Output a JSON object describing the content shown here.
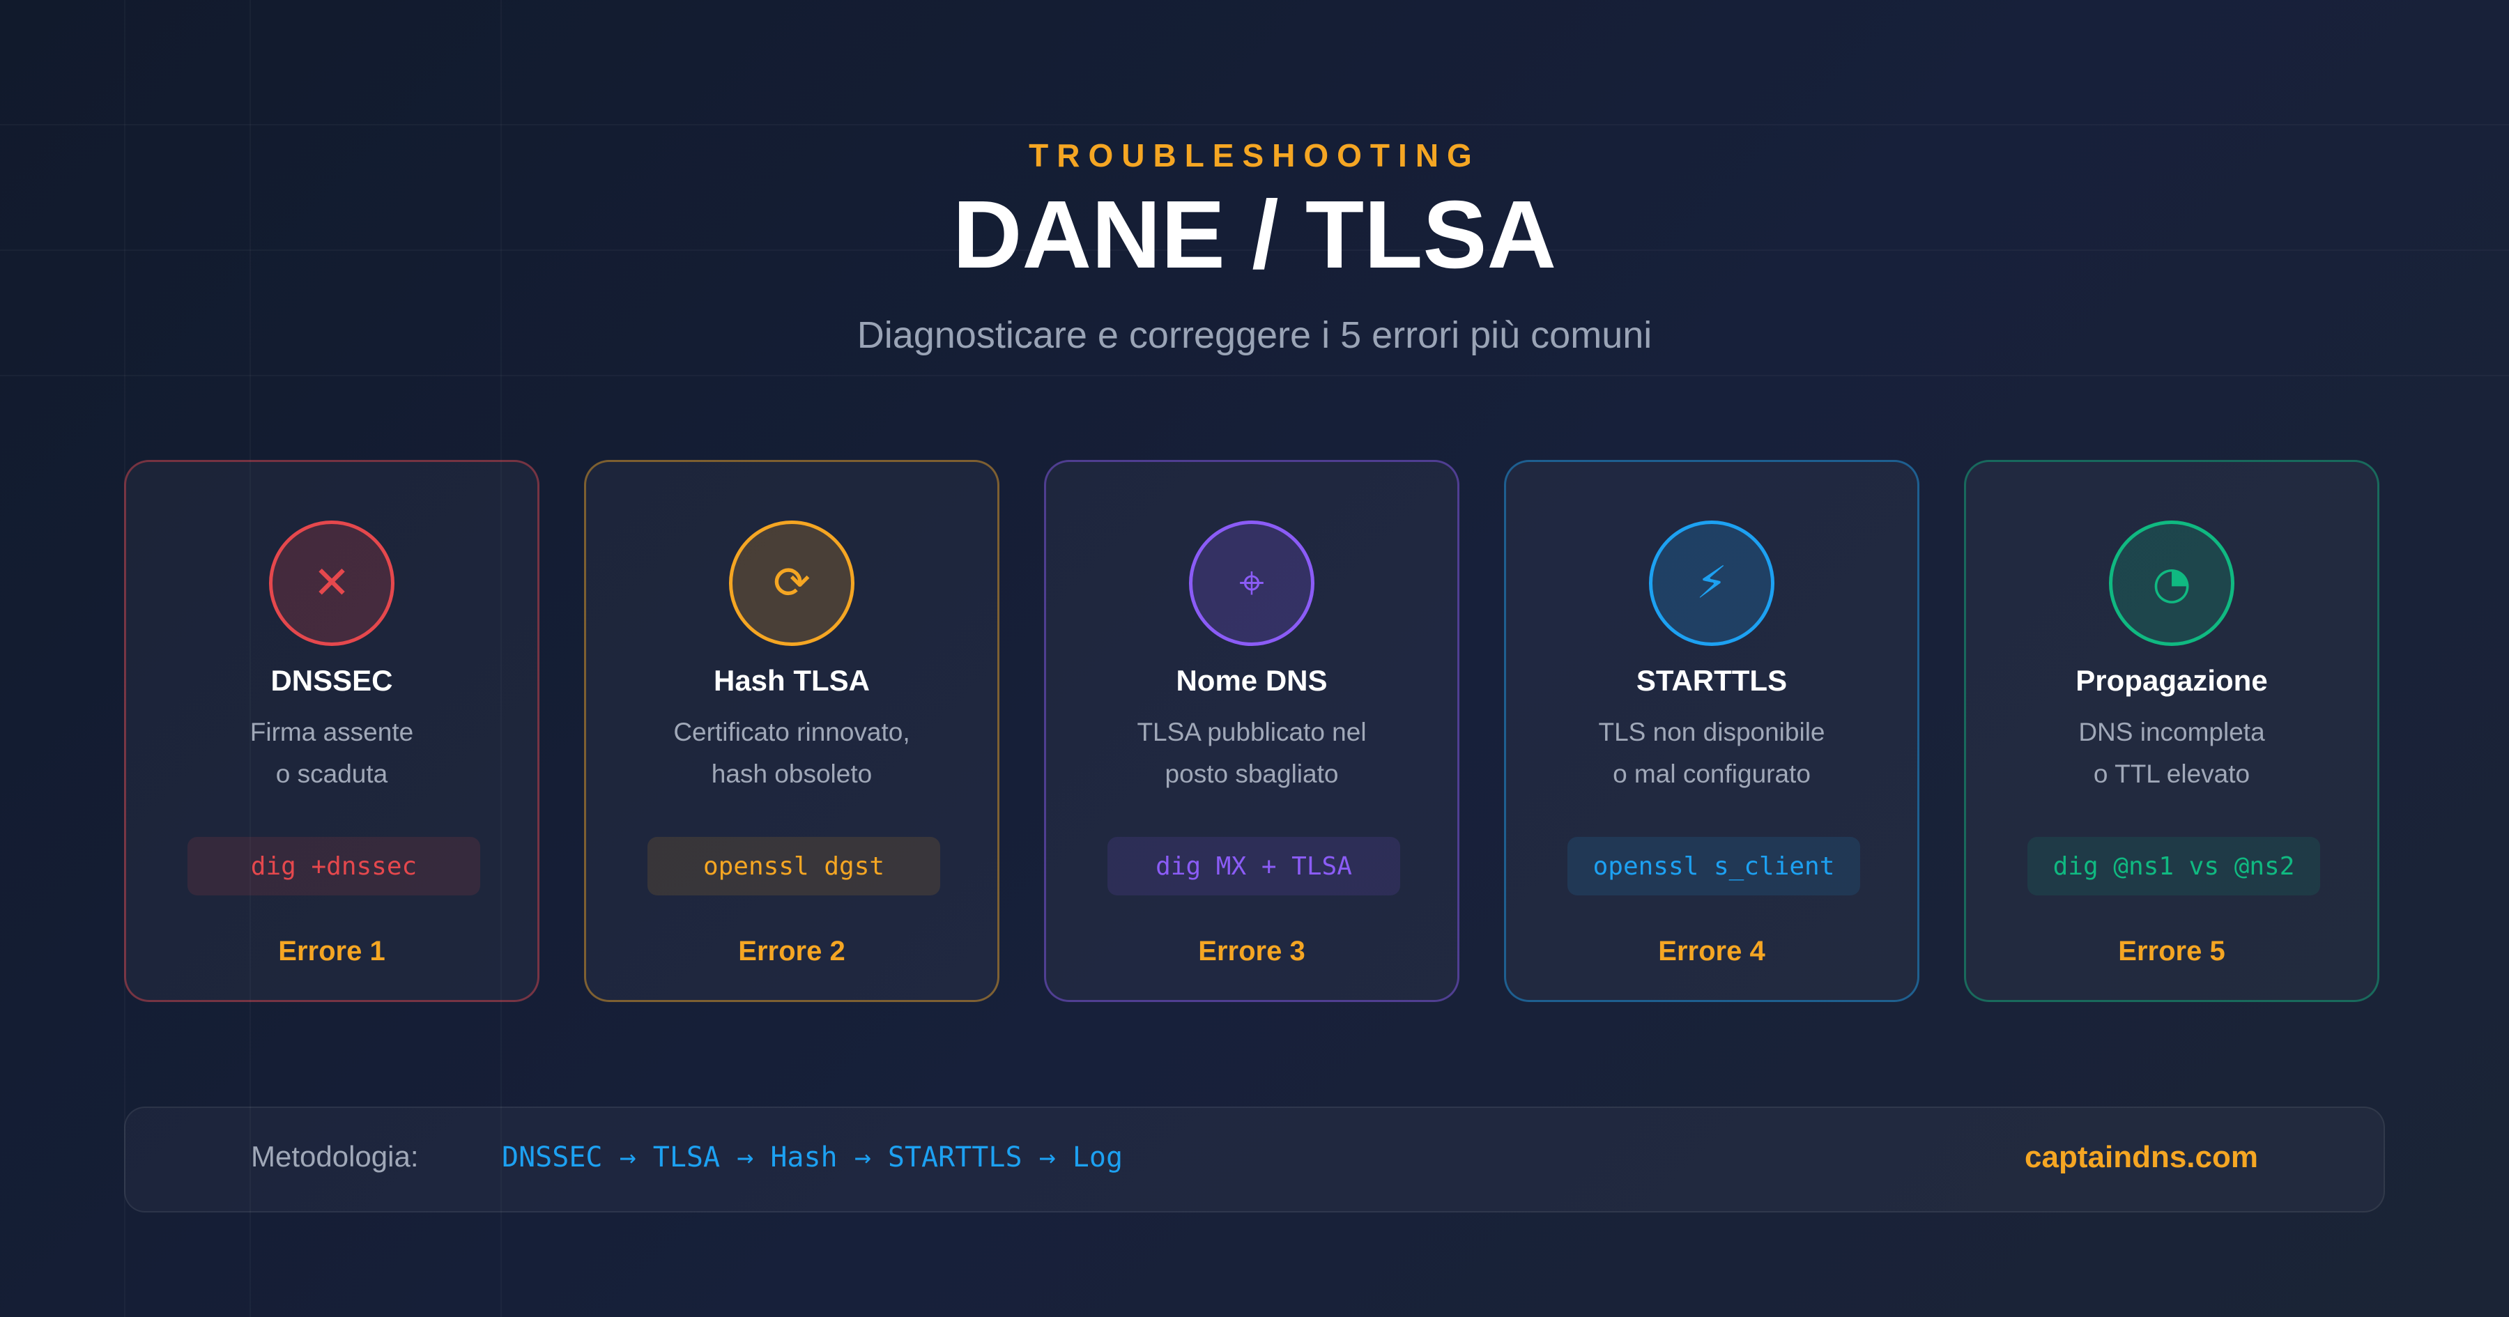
{
  "header": {
    "eyebrow": "TROUBLESHOOTING",
    "title": "DANE / TLSA",
    "subtitle": "Diagnosticare e correggere i 5 errori più comuni"
  },
  "cards": [
    {
      "icon": "x-icon",
      "glyph": "✕",
      "name": "DNSSEC",
      "desc_line1": "Firma assente",
      "desc_line2": "o scaduta",
      "command": "dig +dnssec",
      "label": "Errore 1",
      "accent": "#e5484d"
    },
    {
      "icon": "refresh-icon",
      "glyph": "⟳",
      "name": "Hash TLSA",
      "desc_line1": "Certificato rinnovato,",
      "desc_line2": "hash obsoleto",
      "command": "openssl dgst",
      "label": "Errore 2",
      "accent": "#f5a623"
    },
    {
      "icon": "crosshair-icon",
      "glyph": "⌖",
      "name": "Nome DNS",
      "desc_line1": "TLSA pubblicato nel",
      "desc_line2": "posto sbagliato",
      "command": "dig MX + TLSA",
      "label": "Errore 3",
      "accent": "#8b5cf6"
    },
    {
      "icon": "lightning-icon",
      "glyph": "⚡",
      "name": "STARTTLS",
      "desc_line1": "TLS non disponibile",
      "desc_line2": "o mal configurato",
      "command": "openssl s_client",
      "label": "Errore 4",
      "accent": "#1da1f2"
    },
    {
      "icon": "pie-clock-icon",
      "glyph": "◔",
      "name": "Propagazione",
      "desc_line1": "DNS incompleta",
      "desc_line2": "o TTL elevato",
      "command": "dig @ns1 vs @ns2",
      "label": "Errore 5",
      "accent": "#10b981"
    }
  ],
  "footer": {
    "label": "Metodologia:",
    "flow": "DNSSEC → TLSA → Hash → STARTTLS → Log",
    "brand": "captaindns.com"
  }
}
